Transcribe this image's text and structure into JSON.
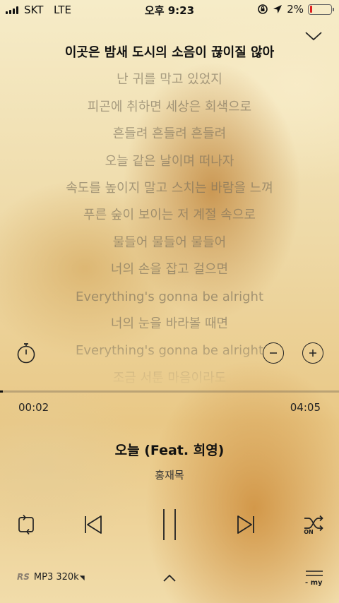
{
  "status_bar": {
    "carrier": "SKT",
    "network": "LTE",
    "time": "오후 9:23",
    "battery_text": "2%",
    "battery_level": 0.02
  },
  "lyrics": {
    "lines": [
      "이곳은 밤새 도시의 소음이 끊이질 않아",
      "난 귀를 막고 있었지",
      "피곤에 취하면 세상은 회색으로",
      "흔들려 흔들려 흔들려",
      "오늘 같은 날이며 떠나자",
      "속도를 높이지 말고 스치는 바람을 느껴",
      "푸른 숲이 보이는 저 계절 속으로",
      "물들어 물들어 물들어",
      "너의 손을 잡고 걸으면",
      "Everything's gonna be alright",
      "너의 눈을 바라볼 때면",
      "Everything's gonna be alright",
      "조금 서툰 마음이라도"
    ],
    "current_index": 0
  },
  "player": {
    "elapsed": "00:02",
    "total": "04:05",
    "progress": 0.008,
    "song_title": "오늘 (Feat. 희영)",
    "artist": "홍재목",
    "shuffle_state": "ON"
  },
  "bottom_bar": {
    "logo": "RS",
    "quality": "MP3 320k",
    "mylist_label": "- my"
  },
  "icons": {
    "collapse": "chevron-down-icon",
    "timer": "stopwatch-icon",
    "repeat": "repeat-icon",
    "prev": "skip-previous-icon",
    "pause": "pause-icon",
    "next": "skip-next-icon",
    "shuffle": "shuffle-icon",
    "up": "chevron-up-icon",
    "mylist": "playlist-icon"
  }
}
